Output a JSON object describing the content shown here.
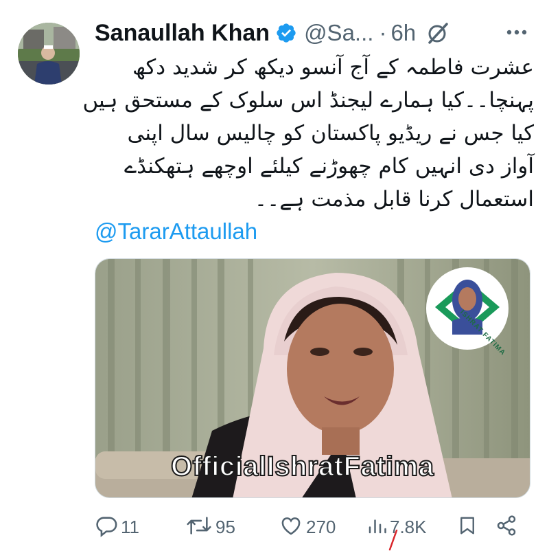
{
  "tweet": {
    "author": {
      "display_name": "Sanaullah Khan",
      "handle": "@Sa...",
      "verified": true
    },
    "separator": "·",
    "time": "6h",
    "text_lines": [
      "عشرت فاطمہ کے آج آنسو دیکھ کر شدید دکھ",
      "پہنچا۔۔کیا ہمارے لیجنڈ اس سلوک کے مستحق ہیں",
      "کیا جس نے ریڈیو پاکستان کو چالیس سال اپنی",
      "آواز دی انہیں کام چھوڑنے کیلئے اوچھے ہتھکنڈے",
      "استعمال کرنا قابل مذمت ہے۔۔"
    ],
    "mention": "@TararAttaullah",
    "media": {
      "watermark": "OfficialIshratFatima",
      "logo_caption": "ISHRAT FATIMA",
      "accent_color": "#1a9a5a"
    },
    "stats": {
      "replies": "11",
      "reposts": "95",
      "likes": "270",
      "views": "7.8K"
    }
  },
  "colors": {
    "text": "#0f1419",
    "secondary": "#536471",
    "link": "#1d9bf0",
    "verified": "#1d9bf0"
  },
  "icons": [
    "reply-icon",
    "repost-icon",
    "like-icon",
    "views-icon",
    "bookmark-icon",
    "share-icon",
    "verified-badge-icon",
    "grok-icon",
    "more-icon"
  ]
}
